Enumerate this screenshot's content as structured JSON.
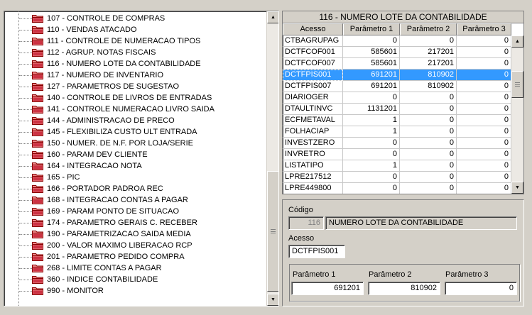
{
  "tree": {
    "items": [
      "107 - CONTROLE DE COMPRAS",
      "110 - VENDAS ATACADO",
      "111 - CONTROLE DE NUMERACAO TIPOS",
      "112 - AGRUP. NOTAS FISCAIS",
      "116 - NUMERO LOTE DA CONTABILIDADE",
      "117 - NUMERO DE INVENTARIO",
      "127 - PARAMETROS DE SUGESTAO",
      "140 - CONTROLE DE LIVROS DE ENTRADAS",
      "141 - CONTROLE NUMERACAO LIVRO SAIDA",
      "144 - ADMINISTRACAO DE PRECO",
      "145 - FLEXIBILIZA CUSTO ULT ENTRADA",
      "150 - NUMER. DE N.F. POR LOJA/SERIE",
      "160 - PARAM DEV CLIENTE",
      "164 - INTEGRACAO NOTA",
      "165 - PIC",
      "166 - PORTADOR PADROA REC",
      "168 - INTEGRACAO CONTAS A PAGAR",
      "169 - PARAM PONTO DE SITUACAO",
      "174 - PARAMETRO GERAIS C. RECEBER",
      "190 - PARAMETRIZACAO SAIDA MEDIA",
      "200 - VALOR MAXIMO LIBERACAO RCP",
      "201 - PARAMETRO PEDIDO COMPRA",
      "268 - LIMITE CONTAS A PAGAR",
      "360 - INDICE CONTABILIDADE",
      "990 - MONITOR"
    ],
    "folder_color": "#cc3344"
  },
  "table": {
    "title": "116 - NUMERO LOTE DA CONTABILIDADE",
    "columns": [
      "Acesso",
      "Parâmetro 1",
      "Parâmetro 2",
      "Parâmetro 3"
    ],
    "rows": [
      [
        "CTBAGRUPAG",
        "0",
        "0",
        "0"
      ],
      [
        "DCTFCOF001",
        "585601",
        "217201",
        "0"
      ],
      [
        "DCTFCOF007",
        "585601",
        "217201",
        "0"
      ],
      [
        "DCTFPIS001",
        "691201",
        "810902",
        "0"
      ],
      [
        "DCTFPIS007",
        "691201",
        "810902",
        "0"
      ],
      [
        "DIARIOGER",
        "0",
        "0",
        "0"
      ],
      [
        "DTAULTINVC",
        "1131201",
        "0",
        "0"
      ],
      [
        "ECFMETAVAL",
        "1",
        "0",
        "0"
      ],
      [
        "FOLHACIAP",
        "1",
        "0",
        "0"
      ],
      [
        "INVESTZERO",
        "0",
        "0",
        "0"
      ],
      [
        "INVRETRO",
        "0",
        "0",
        "0"
      ],
      [
        "LISTATIPO",
        "1",
        "0",
        "0"
      ],
      [
        "LPRE217512",
        "0",
        "0",
        "0"
      ],
      [
        "LPRE449800",
        "0",
        "0",
        "0"
      ]
    ],
    "selected_row": 3,
    "selection_color": "#3399ff"
  },
  "form": {
    "codigo_label": "Código",
    "codigo_value": "116",
    "descricao_value": "NUMERO LOTE DA CONTABILIDADE",
    "acesso_label": "Acesso",
    "acesso_value": "DCTFPIS001",
    "p1_label": "Parâmetro 1",
    "p1_value": "691201",
    "p2_label": "Parâmetro 2",
    "p2_value": "810902",
    "p3_label": "Parâmetro 3",
    "p3_value": "0"
  },
  "icons": {
    "folder": "folder-icon",
    "scroll_up": "arrow-up-icon",
    "scroll_down": "arrow-down-icon"
  }
}
